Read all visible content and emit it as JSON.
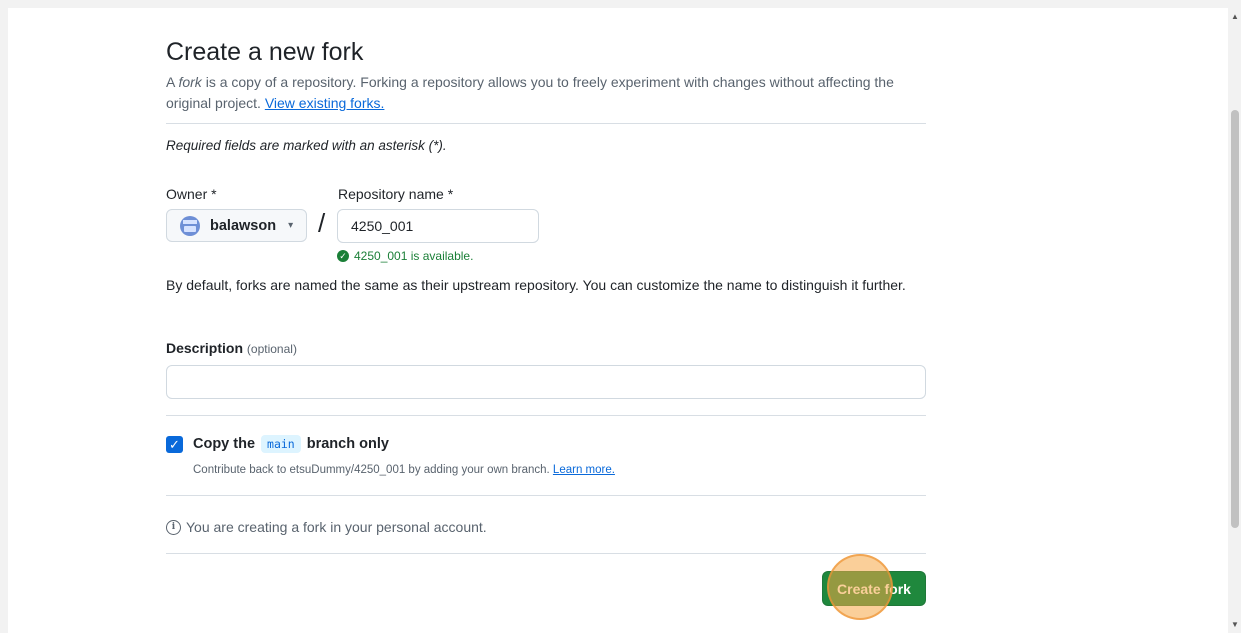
{
  "page": {
    "title": "Create a new fork",
    "intro_prefix": "A ",
    "intro_fork_word": "fork",
    "intro_rest": " is a copy of a repository. Forking a repository allows you to freely experiment with changes without affecting the original project. ",
    "view_forks_link": "View existing forks.",
    "required_note": "Required fields are marked with an asterisk (*)."
  },
  "owner": {
    "label": "Owner *",
    "value": "balawson"
  },
  "repo": {
    "label": "Repository name *",
    "value": "4250_001",
    "availability": "4250_001 is available."
  },
  "default_note": "By default, forks are named the same as their upstream repository. You can customize the name to distinguish it further.",
  "description": {
    "label": "Description",
    "optional": "(optional)",
    "value": ""
  },
  "copy_branch": {
    "checked": true,
    "label_prefix": "Copy the",
    "branch": "main",
    "label_suffix": "branch only",
    "help": "Contribute back to etsuDummy/4250_001 by adding your own branch. ",
    "learn_more": "Learn more."
  },
  "info_note": "You are creating a fork in your personal account.",
  "submit": {
    "label": "Create fork",
    "color": "#1f883d"
  }
}
